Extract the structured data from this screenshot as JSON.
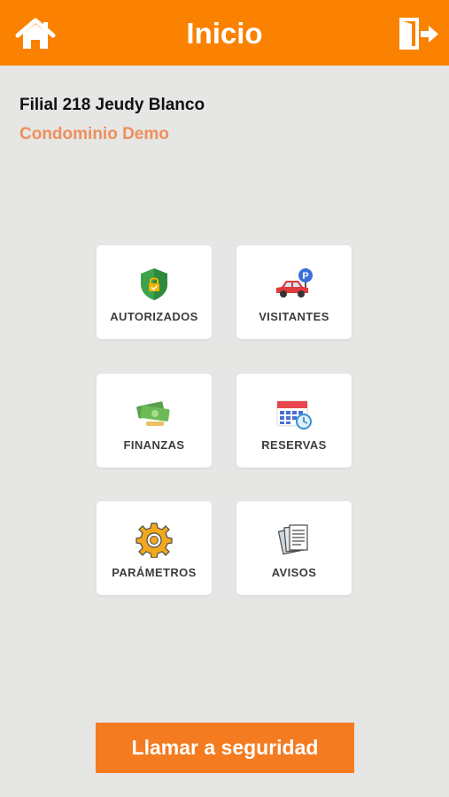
{
  "header": {
    "title": "Inicio",
    "home_icon": "home-icon",
    "exit_icon": "exit-door-icon",
    "accent_color": "#fa8200"
  },
  "user": {
    "unit": "Filial 218 Jeudy Blanco",
    "condominium": "Condominio Demo"
  },
  "menu": [
    {
      "label": "AUTORIZADOS",
      "icon": "shield-check-icon"
    },
    {
      "label": "VISITANTES",
      "icon": "car-parking-icon"
    },
    {
      "label": "FINANZAS",
      "icon": "money-icon"
    },
    {
      "label": "RESERVAS",
      "icon": "calendar-clock-icon"
    },
    {
      "label": "PARÁMETROS",
      "icon": "gear-icon"
    },
    {
      "label": "AVISOS",
      "icon": "documents-icon"
    }
  ],
  "footer": {
    "call_security_label": "Llamar a seguridad",
    "button_color": "#f47b20"
  }
}
